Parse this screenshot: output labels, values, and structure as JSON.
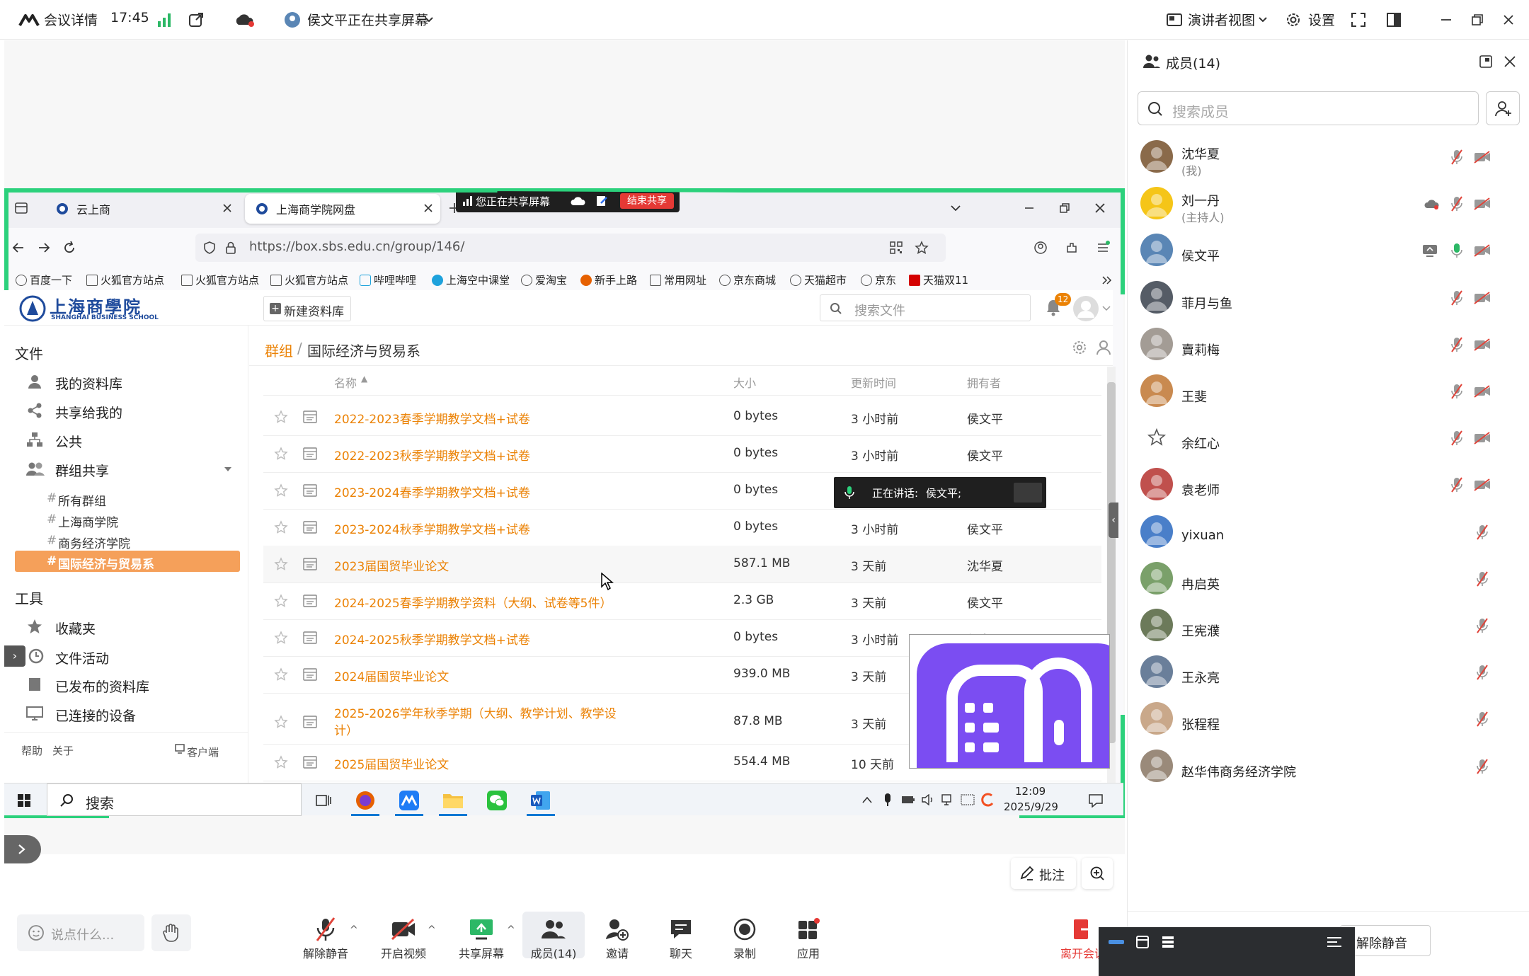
{
  "topbar": {
    "meeting_details": "会议详情",
    "time": "17:45",
    "sharing_status": "侯文平正在共享屏幕",
    "presenter_view": "演讲者视图",
    "settings": "设置"
  },
  "browser": {
    "tabs": [
      {
        "label": "云上商",
        "active": false
      },
      {
        "label": "上海商学院网盘",
        "active": true
      }
    ],
    "share_banner": {
      "text": "您正在共享屏幕",
      "end_label": "结束共享"
    },
    "url": "https://box.sbs.edu.cn/group/146/",
    "bookmarks": [
      "百度一下",
      "火狐官方站点",
      "火狐官方站点",
      "火狐官方站点",
      "哔哩哔哩",
      "上海空中课堂",
      "爱淘宝",
      "新手上路",
      "常用网址",
      "京东商城",
      "天猫超市",
      "京东",
      "天猫双11"
    ]
  },
  "seafile": {
    "logo_cn": "上海商學院",
    "logo_en": "SHANGHAI BUSINESS SCHOOL",
    "new_library": "新建资料库",
    "search_placeholder": "搜索文件",
    "notification_count": "12",
    "sidebar": {
      "files_heading": "文件",
      "items": [
        "我的资料库",
        "共享给我的",
        "公共",
        "群组共享"
      ],
      "groups": [
        "所有群组",
        "上海商学院",
        "商务经济学院",
        "国际经济与贸易系"
      ],
      "tools_heading": "工具",
      "tools": [
        "收藏夹",
        "文件活动",
        "已发布的资料库",
        "已连接的设备"
      ],
      "footer_help": "帮助",
      "footer_about": "关于",
      "footer_client": "客户端"
    },
    "breadcrumb_group": "群组",
    "breadcrumb_sep": "/",
    "breadcrumb_current": "国际经济与贸易系",
    "columns": {
      "name": "名称",
      "size": "大小",
      "updated": "更新时间",
      "owner": "拥有者"
    },
    "rows": [
      {
        "name": "2022-2023春季学期教学文档+试卷",
        "size": "0 bytes",
        "updated": "3 小时前",
        "owner": "侯文平"
      },
      {
        "name": "2022-2023秋季学期教学文档+试卷",
        "size": "0 bytes",
        "updated": "3 小时前",
        "owner": "侯文平"
      },
      {
        "name": "2023-2024春季学期教学文档+试卷",
        "size": "0 bytes",
        "updated": "",
        "owner": ""
      },
      {
        "name": "2023-2024秋季学期教学文档+试卷",
        "size": "0 bytes",
        "updated": "3 小时前",
        "owner": "侯文平"
      },
      {
        "name": "2023届国贸毕业论文",
        "size": "587.1 MB",
        "updated": "3 天前",
        "owner": "沈华夏"
      },
      {
        "name": "2024-2025春季学期教学资料（大纲、试卷等5件）",
        "size": "2.3 GB",
        "updated": "3 天前",
        "owner": "侯文平"
      },
      {
        "name": "2024-2025秋季学期教学文档+试卷",
        "size": "0 bytes",
        "updated": "3 小时前",
        "owner": "侯文平"
      },
      {
        "name": "2024届国贸毕业论文",
        "size": "939.0 MB",
        "updated": "3 天前",
        "owner": ""
      },
      {
        "name": "2025-2026学年秋季学期（大纲、教学计划、教学设计）",
        "size": "87.8 MB",
        "updated": "3 天前",
        "owner": ""
      },
      {
        "name": "2025届国贸毕业论文",
        "size": "554.4 MB",
        "updated": "10 天前",
        "owner": ""
      }
    ],
    "speaking_label": "正在讲话:",
    "speaking_name": "侯文平;"
  },
  "taskbar": {
    "search_placeholder": "搜索",
    "time": "12:09",
    "date": "2025/9/29"
  },
  "members": {
    "title": "成员(14)",
    "search_placeholder": "搜索成员",
    "list": [
      {
        "name": "沈华夏",
        "sub": "(我)",
        "color": "#8a6a4a"
      },
      {
        "name": "刘一丹",
        "sub": "(主持人)",
        "color": "#f5c518"
      },
      {
        "name": "侯文平",
        "sub": "",
        "color": "#5a86b5"
      },
      {
        "name": "菲月与鱼",
        "sub": "",
        "color": "#555c66"
      },
      {
        "name": "賣莉梅",
        "sub": "",
        "color": "#a39c95"
      },
      {
        "name": "王斐",
        "sub": "",
        "color": "#c98a50"
      },
      {
        "name": "余红心",
        "sub": "",
        "color": "#ffffff"
      },
      {
        "name": "袁老师",
        "sub": "",
        "color": "#c0504d"
      },
      {
        "name": "yixuan",
        "sub": "",
        "color": "#4a7fc9"
      },
      {
        "name": "冉启英",
        "sub": "",
        "color": "#7aa06a"
      },
      {
        "name": "王宪濮",
        "sub": "",
        "color": "#6c7a5a"
      },
      {
        "name": "王永亮",
        "sub": "",
        "color": "#6a7f9a"
      },
      {
        "name": "张程程",
        "sub": "",
        "color": "#c9a88a"
      },
      {
        "name": "赵华伟商务经济学院",
        "sub": "",
        "color": "#9a8a7a"
      }
    ]
  },
  "bottombar": {
    "chat_placeholder": "说点什么...",
    "buttons": [
      "解除静音",
      "开启视频",
      "共享屏幕",
      "成员(14)",
      "邀请",
      "聊天",
      "录制",
      "应用"
    ],
    "leave": "离开会议",
    "annotate": "批注",
    "unmute": "解除静音"
  },
  "colors": {
    "accent_green": "#2cd17c",
    "seafile_orange": "#eb8205",
    "mute_red": "#e0443a",
    "share_red": "#e53935"
  }
}
